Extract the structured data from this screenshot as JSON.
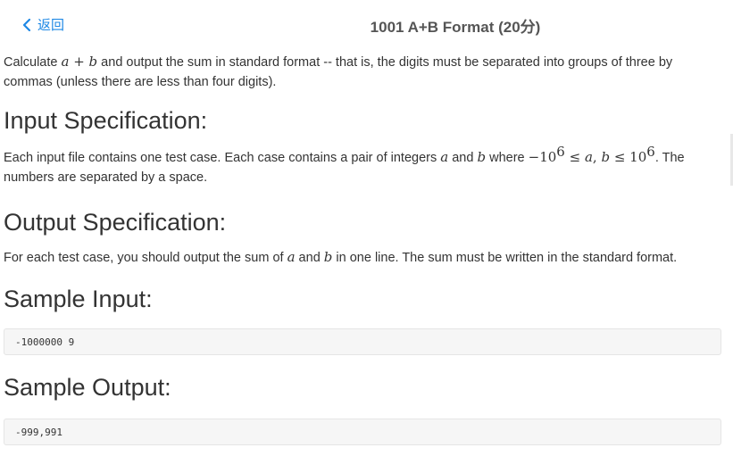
{
  "header": {
    "back_label": "返回",
    "title": "1001 A+B Format (20分)"
  },
  "problem": {
    "desc": {
      "p1": "Calculate ",
      "var_a": "a",
      "op_plus": " + ",
      "var_b": "b",
      "p2": " and output the sum in standard format -- that is, the digits must be separated into groups of three by commas (unless there are less than four digits)."
    },
    "input_spec": {
      "heading": "Input Specification:",
      "p1": "Each input file contains one test case. Each case contains a pair of integers ",
      "var_a": "a",
      "p2": " and ",
      "var_b": "b",
      "p3": " where ",
      "m_neg": "−10",
      "m_exp1": "6",
      "m_le1": " ≤ ",
      "m_a": "a",
      "m_comma": ", ",
      "m_b": "b",
      "m_le2": " ≤ ",
      "m_10": "10",
      "m_exp2": "6",
      "p4": ". The numbers are separated by a space."
    },
    "output_spec": {
      "heading": "Output Specification:",
      "p1": "For each test case, you should output the sum of ",
      "var_a": "a",
      "p2": " and ",
      "var_b": "b",
      "p3": " in one line. The sum must be written in the standard format."
    },
    "sample_input": {
      "heading": "Sample Input:",
      "code": "-1000000 9"
    },
    "sample_output": {
      "heading": "Sample Output:",
      "code": "-999,991"
    }
  }
}
